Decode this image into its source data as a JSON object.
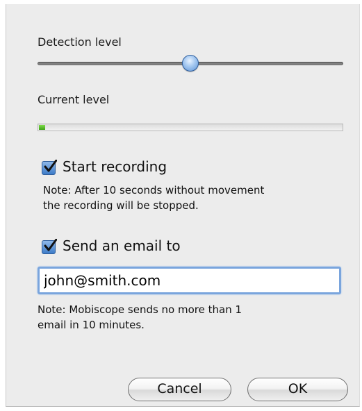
{
  "detection": {
    "label": "Detection level",
    "value_fraction": 0.5
  },
  "current": {
    "label": "Current level",
    "value_fraction": 0.02
  },
  "recording": {
    "checked": true,
    "label": "Start recording",
    "note_line1": "Note: After 10 seconds without movement",
    "note_line2": "the recording will be stopped."
  },
  "email": {
    "checked": true,
    "label": "Send an email to",
    "value": "john@smith.com",
    "note_line1": "Note: Mobiscope sends no more than 1",
    "note_line2": "email in 10 minutes."
  },
  "buttons": {
    "cancel": "Cancel",
    "ok": "OK"
  },
  "colors": {
    "accent": "#5f95d6",
    "meter_green": "#4fb82a"
  }
}
